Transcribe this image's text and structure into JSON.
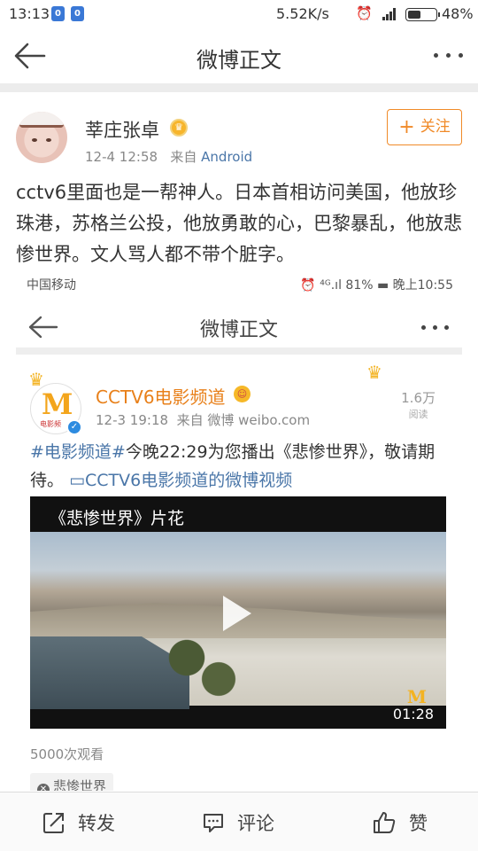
{
  "status_bar": {
    "time": "13:13",
    "app_icon_1": "0",
    "app_icon_2": "0",
    "net_speed": "5.52K/s",
    "battery": "48%",
    "battery_level": 0.48
  },
  "nav": {
    "title": "微博正文"
  },
  "post": {
    "author": "莘庄张卓",
    "date": "12-4 12:58",
    "from_label": "来自",
    "source": "Android",
    "follow_label": "关注",
    "follow_plus": "+",
    "text": "cctv6里面也是一帮神人。日本首相访问美国，他放珍珠港，苏格兰公投，他放勇敢的心，巴黎暴乱，他放悲惨世界。文人骂人都不带个脏字。"
  },
  "embedded": {
    "status": {
      "carrier": "中国移动",
      "right": "⏰ ⁴ᴳ.ıl 81% ▬ 晚上10:55"
    },
    "nav_title": "微博正文",
    "card": {
      "author": "CCTV6电影频道",
      "avatar_letter": "M",
      "avatar_sub": "电影频",
      "date": "12-3 19:18",
      "from_label": "来自",
      "source": "微博 weibo.com",
      "count": "1.6万",
      "count_label": "阅读",
      "tag": "#电影频道#",
      "text": "今晚22:29为您播出《悲惨世界》，敬请期待。",
      "video_link": "CCTV6电影频道的微博视频",
      "video_title": "《悲惨世界》片花",
      "video_logo": "M",
      "duration": "01:28",
      "views": "5000次观看",
      "topic": "悲惨世界"
    }
  },
  "bottom_bar": {
    "repost": "转发",
    "comment": "评论",
    "like": "赞"
  },
  "colors": {
    "accent_orange": "#f08a28",
    "link_blue": "#4a76a8",
    "cctv_orange": "#e8801a"
  }
}
